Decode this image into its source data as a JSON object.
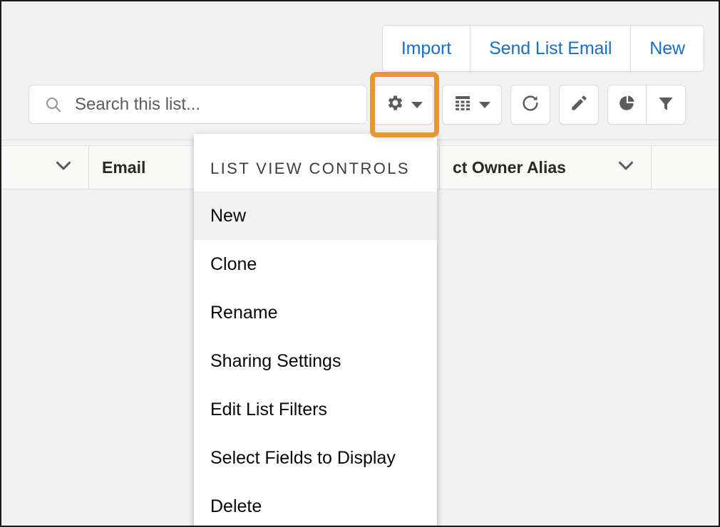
{
  "header": {
    "actions": [
      {
        "label": "Import",
        "name": "import-button"
      },
      {
        "label": "Send List Email",
        "name": "send-list-email-button"
      },
      {
        "label": "New",
        "name": "new-record-button"
      }
    ]
  },
  "search": {
    "placeholder": "Search this list...",
    "value": "",
    "icon": "search-icon"
  },
  "toolbar": {
    "buttons": [
      {
        "name": "list-view-controls-button",
        "icon": "gear-icon",
        "has_caret": true,
        "highlighted": true
      },
      {
        "name": "display-as-button",
        "icon": "table-icon",
        "has_caret": true,
        "highlighted": false
      },
      {
        "name": "refresh-button",
        "icon": "refresh-icon",
        "has_caret": false,
        "highlighted": false
      },
      {
        "name": "edit-button",
        "icon": "pencil-icon",
        "has_caret": false,
        "highlighted": false
      },
      {
        "name": "charts-button",
        "icon": "pie-chart-icon",
        "has_caret": false,
        "highlighted": false
      },
      {
        "name": "filter-button",
        "icon": "funnel-icon",
        "has_caret": false,
        "highlighted": false
      }
    ],
    "highlight_color": "#e8962d"
  },
  "table": {
    "columns": [
      {
        "label": "",
        "name": "select-all-column",
        "sortable": true
      },
      {
        "label": "Email",
        "name": "email-column",
        "sortable": false
      },
      {
        "label": "ct Owner Alias",
        "name": "account-owner-alias-column",
        "sortable": true
      },
      {
        "label": "",
        "name": "trailing-column",
        "sortable": false
      }
    ],
    "rows": []
  },
  "menu": {
    "title": "LIST VIEW CONTROLS",
    "items": [
      {
        "label": "New",
        "active": true
      },
      {
        "label": "Clone",
        "active": false
      },
      {
        "label": "Rename",
        "active": false
      },
      {
        "label": "Sharing Settings",
        "active": false
      },
      {
        "label": "Edit List Filters",
        "active": false
      },
      {
        "label": "Select Fields to Display",
        "active": false
      },
      {
        "label": "Delete",
        "active": false
      }
    ]
  },
  "colors": {
    "link": "#1b6ec2",
    "highlight": "#e8962d",
    "page_bg": "#f3f2f2"
  }
}
